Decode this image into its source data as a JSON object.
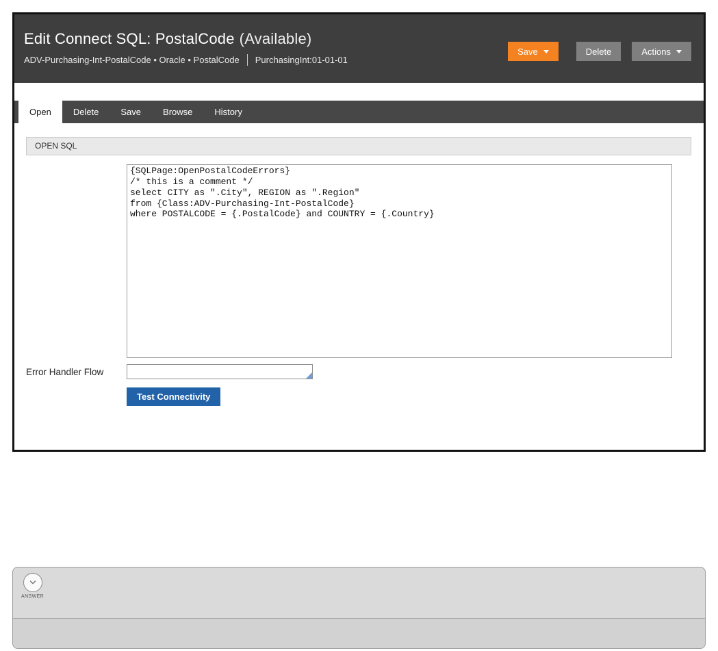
{
  "colors": {
    "header_dark": "#3e3e3e",
    "tabbar_dark": "#474747",
    "save_orange": "#f58220",
    "button_gray": "#7f7f7f",
    "test_button_blue": "#2162a8"
  },
  "header": {
    "title": "Edit Connect SQL: PostalCode",
    "status": "(Available)",
    "rule_key": "ADV-Purchasing-Int-PostalCode • Oracle • PostalCode",
    "ruleset_version": "PurchasingInt:01-01-01",
    "buttons": {
      "save": "Save",
      "delete": "Delete",
      "actions": "Actions"
    }
  },
  "tabs": [
    {
      "label": "Open",
      "active": true
    },
    {
      "label": "Delete",
      "active": false
    },
    {
      "label": "Save",
      "active": false
    },
    {
      "label": "Browse",
      "active": false
    },
    {
      "label": "History",
      "active": false
    }
  ],
  "open_sql": {
    "section_title": "OPEN SQL",
    "sql_text": "{SQLPage:OpenPostalCodeErrors}\n/* this is a comment */\nselect CITY as \".City\", REGION as \".Region\"\nfrom {Class:ADV-Purchasing-Int-PostalCode}\nwhere POSTALCODE = {.PostalCode} and COUNTRY = {.Country}",
    "error_handler": {
      "label": "Error Handler Flow",
      "value": ""
    },
    "test_button_label": "Test Connectivity"
  },
  "answer_panel": {
    "label": "ANSWER"
  }
}
